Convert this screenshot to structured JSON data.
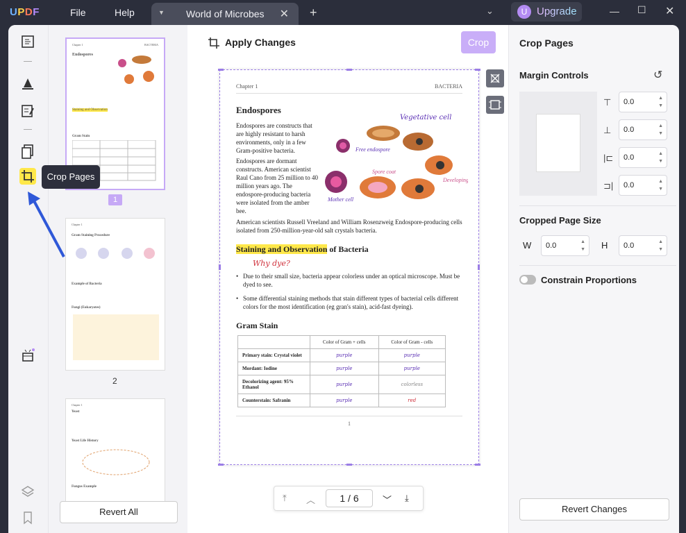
{
  "app": {
    "logo": "UPDF",
    "menu": [
      "File",
      "Help"
    ],
    "tab_title": "World of Microbes",
    "upgrade": "Upgrade",
    "avatar": "U"
  },
  "toolbar": {
    "tooltip": "Crop Pages"
  },
  "thumbs": {
    "labels": [
      "1",
      "2"
    ],
    "revert_all": "Revert All"
  },
  "center": {
    "apply": "Apply Changes",
    "crop": "Crop",
    "page": {
      "chapter": "Chapter 1",
      "section": "BACTERIA",
      "h1": "Endospores",
      "p1": "Endospores are constructs that are highly resistant to harsh environments, only in a few Gram-positive bacteria.",
      "p2": "Endospores are dormant constructs. American scientist Raul Cano from 25 million to 40 million years ago. The endospore-producing bacteria were isolated from the amber bee.",
      "p3": "American scientists Russell Vreeland and William Rosenzweig Endospore-producing cells isolated from 250-million-year-old salt crystals bacteria.",
      "diagram_labels": [
        "Vegetative cell",
        "Free endospore",
        "Spore coat",
        "Developing spore coat",
        "Mother cell"
      ],
      "h2_hl": "Staining and Observation",
      "h2_rest": " of Bacteria",
      "why": "Why dye?",
      "b1": "Due to their small size, bacteria appear colorless under an optical microscope. Must be dyed to see.",
      "b2": "Some differential staining methods that stain different types of bacterial cells different colors for the most identification (eg gran's stain), acid-fast dyeing).",
      "h3": "Gram Stain",
      "table_head": [
        "Color of Gram + cells",
        "Color of Gram - cells"
      ],
      "table_rows": [
        [
          "Primary stain: Crystal violet",
          "purple",
          "purple"
        ],
        [
          "Mordant: Iodine",
          "purple",
          "purple"
        ],
        [
          "Decolorizing agent: 95% Ethanol",
          "purple",
          "colorless"
        ],
        [
          "Counterstain: Safranin",
          "purple",
          "red"
        ]
      ],
      "page_num": "1"
    },
    "pager": {
      "current": "1",
      "sep": "/",
      "total": "6"
    }
  },
  "right": {
    "title": "Crop Pages",
    "margin": "Margin Controls",
    "margins": [
      "0.0",
      "0.0",
      "0.0",
      "0.0"
    ],
    "size_title": "Cropped Page Size",
    "w_label": "W",
    "w": "0.0",
    "h_label": "H",
    "h": "0.0",
    "constrain": "Constrain Proportions",
    "revert": "Revert Changes"
  },
  "colors": {
    "accent": "#c6a9f6",
    "highlight": "#ffe84a"
  }
}
